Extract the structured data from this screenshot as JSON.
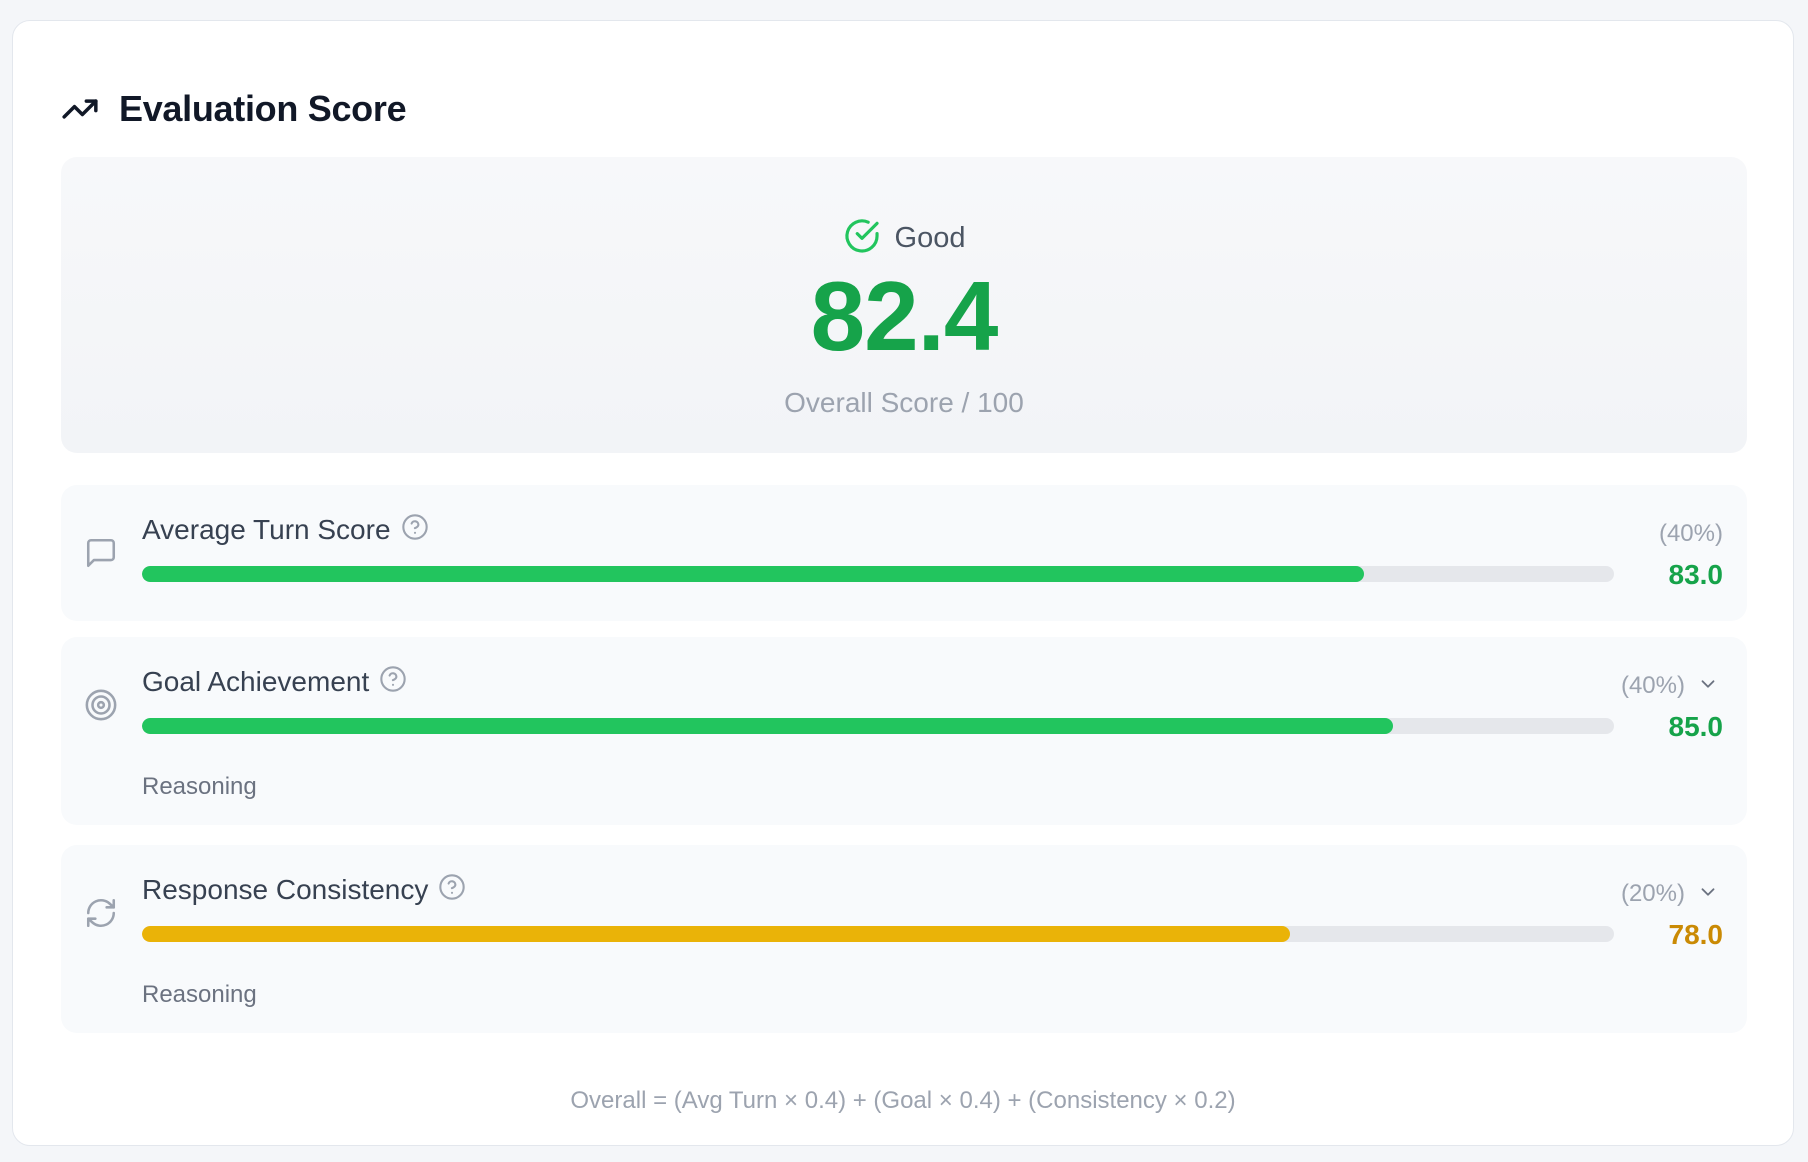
{
  "header": {
    "title": "Evaluation Score",
    "icon": "trending-up-icon"
  },
  "overall": {
    "status_label": "Good",
    "status_icon": "check-circle-icon",
    "score": "82.4",
    "caption": "Overall Score / 100",
    "color": "#16a34a"
  },
  "metrics": [
    {
      "name": "Average Turn Score",
      "icon": "message-square-icon",
      "weight": "(40%)",
      "value": "83.0",
      "score": 83.0,
      "color": "#22c55e",
      "value_color": "#16a34a",
      "expandable": false
    },
    {
      "name": "Goal Achievement",
      "icon": "target-icon",
      "weight": "(40%)",
      "value": "85.0",
      "score": 85.0,
      "color": "#22c55e",
      "value_color": "#16a34a",
      "expandable": true,
      "reasoning_label": "Reasoning"
    },
    {
      "name": "Response Consistency",
      "icon": "refresh-icon",
      "weight": "(20%)",
      "value": "78.0",
      "score": 78.0,
      "color": "#eab308",
      "value_color": "#ca8a04",
      "expandable": true,
      "reasoning_label": "Reasoning"
    }
  ],
  "formula": "Overall = (Avg Turn × 0.4) + (Goal × 0.4) + (Consistency × 0.2)"
}
